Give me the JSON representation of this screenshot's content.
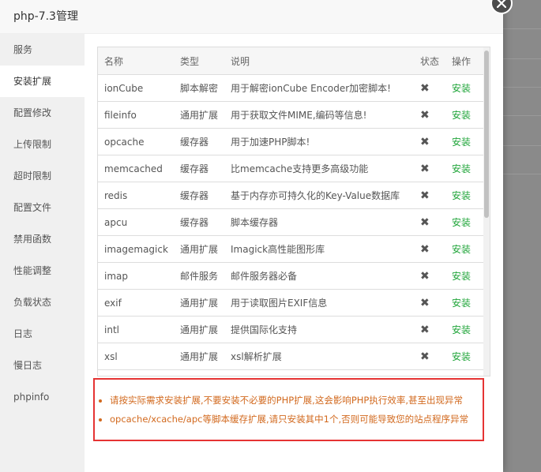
{
  "dialog": {
    "title": "php-7.3管理"
  },
  "sidebar": {
    "items": [
      {
        "label": "服务"
      },
      {
        "label": "安装扩展"
      },
      {
        "label": "配置修改"
      },
      {
        "label": "上传限制"
      },
      {
        "label": "超时限制"
      },
      {
        "label": "配置文件"
      },
      {
        "label": "禁用函数"
      },
      {
        "label": "性能调整"
      },
      {
        "label": "负载状态"
      },
      {
        "label": "日志"
      },
      {
        "label": "慢日志"
      },
      {
        "label": "phpinfo"
      }
    ],
    "active_index": 1
  },
  "table": {
    "headers": {
      "name": "名称",
      "type": "类型",
      "desc": "说明",
      "status": "状态",
      "op": "操作"
    },
    "rows": [
      {
        "name": "ionCube",
        "type": "脚本解密",
        "desc": "用于解密ionCube Encoder加密脚本!",
        "status": "✖",
        "op": "安装"
      },
      {
        "name": "fileinfo",
        "type": "通用扩展",
        "desc": "用于获取文件MIME,编码等信息!",
        "status": "✖",
        "op": "安装"
      },
      {
        "name": "opcache",
        "type": "缓存器",
        "desc": "用于加速PHP脚本!",
        "status": "✖",
        "op": "安装"
      },
      {
        "name": "memcached",
        "type": "缓存器",
        "desc": "比memcache支持更多高级功能",
        "status": "✖",
        "op": "安装"
      },
      {
        "name": "redis",
        "type": "缓存器",
        "desc": "基于内存亦可持久化的Key-Value数据库",
        "status": "✖",
        "op": "安装"
      },
      {
        "name": "apcu",
        "type": "缓存器",
        "desc": "脚本缓存器",
        "status": "✖",
        "op": "安装"
      },
      {
        "name": "imagemagick",
        "type": "通用扩展",
        "desc": "Imagick高性能图形库",
        "status": "✖",
        "op": "安装"
      },
      {
        "name": "imap",
        "type": "邮件服务",
        "desc": "邮件服务器必备",
        "status": "✖",
        "op": "安装"
      },
      {
        "name": "exif",
        "type": "通用扩展",
        "desc": "用于读取图片EXIF信息",
        "status": "✖",
        "op": "安装"
      },
      {
        "name": "intl",
        "type": "通用扩展",
        "desc": "提供国际化支持",
        "status": "✖",
        "op": "安装"
      },
      {
        "name": "xsl",
        "type": "通用扩展",
        "desc": "xsl解析扩展",
        "status": "✖",
        "op": "安装"
      }
    ]
  },
  "notice": {
    "items": [
      "请按实际需求安装扩展,不要安装不必要的PHP扩展,这会影响PHP执行效率,甚至出现异常",
      "opcache/xcache/apc等脚本缓存扩展,请只安装其中1个,否则可能导致您的站点程序异常"
    ]
  },
  "colors": {
    "install_link": "#20a53a",
    "notice_border": "#e53333",
    "notice_text": "#d2691e"
  }
}
